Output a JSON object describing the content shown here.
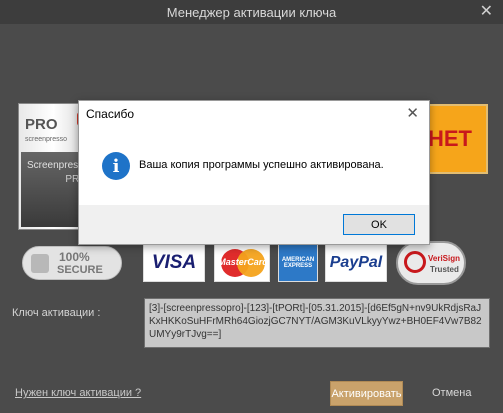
{
  "window": {
    "title": "Менеджер активации ключа",
    "close_glyph": "✕"
  },
  "product": {
    "pro": "PRO",
    "brand": "screenpresso",
    "name": "Screenpresso",
    "edition": "PRO"
  },
  "buy_banner": {
    "text": "НЕТ",
    "color": "#f6a51a"
  },
  "badges": {
    "secure_line1": "100%",
    "secure_line2": "SECURE",
    "visa": "VISA",
    "mastercard": "MasterCard",
    "amex": "AMERICAN EXPRESS",
    "paypal": "PayPal",
    "verisign_line1": "VeriSign",
    "verisign_line2": "Trusted"
  },
  "activation": {
    "key_label": "Ключ активации :",
    "key_value": "[3]-[screenpressopro]-[123]-[tPORt]-[05.31.2015]-[d6Ef5gN+nv9UkRdjsRaJKxHKKoSuHFrMRh64GiozjGC7NYT/AGM3KuVLkyyYwz+BH0EF4Vw7B82UMYy9rTJvg==]",
    "need_key_link": "Нужен ключ активации ?",
    "activate_button": "Активировать",
    "cancel_button": "Отмена"
  },
  "dialog": {
    "title": "Спасибо",
    "close_glyph": "✕",
    "icon": "info-icon",
    "icon_glyph": "i",
    "message": "Ваша копия программы успешно активирована.",
    "ok_button": "OK"
  },
  "colors": {
    "window_bg": "#4b4b4b",
    "accent_blue": "#0078d7",
    "activate_bg": "#c9a26b"
  }
}
